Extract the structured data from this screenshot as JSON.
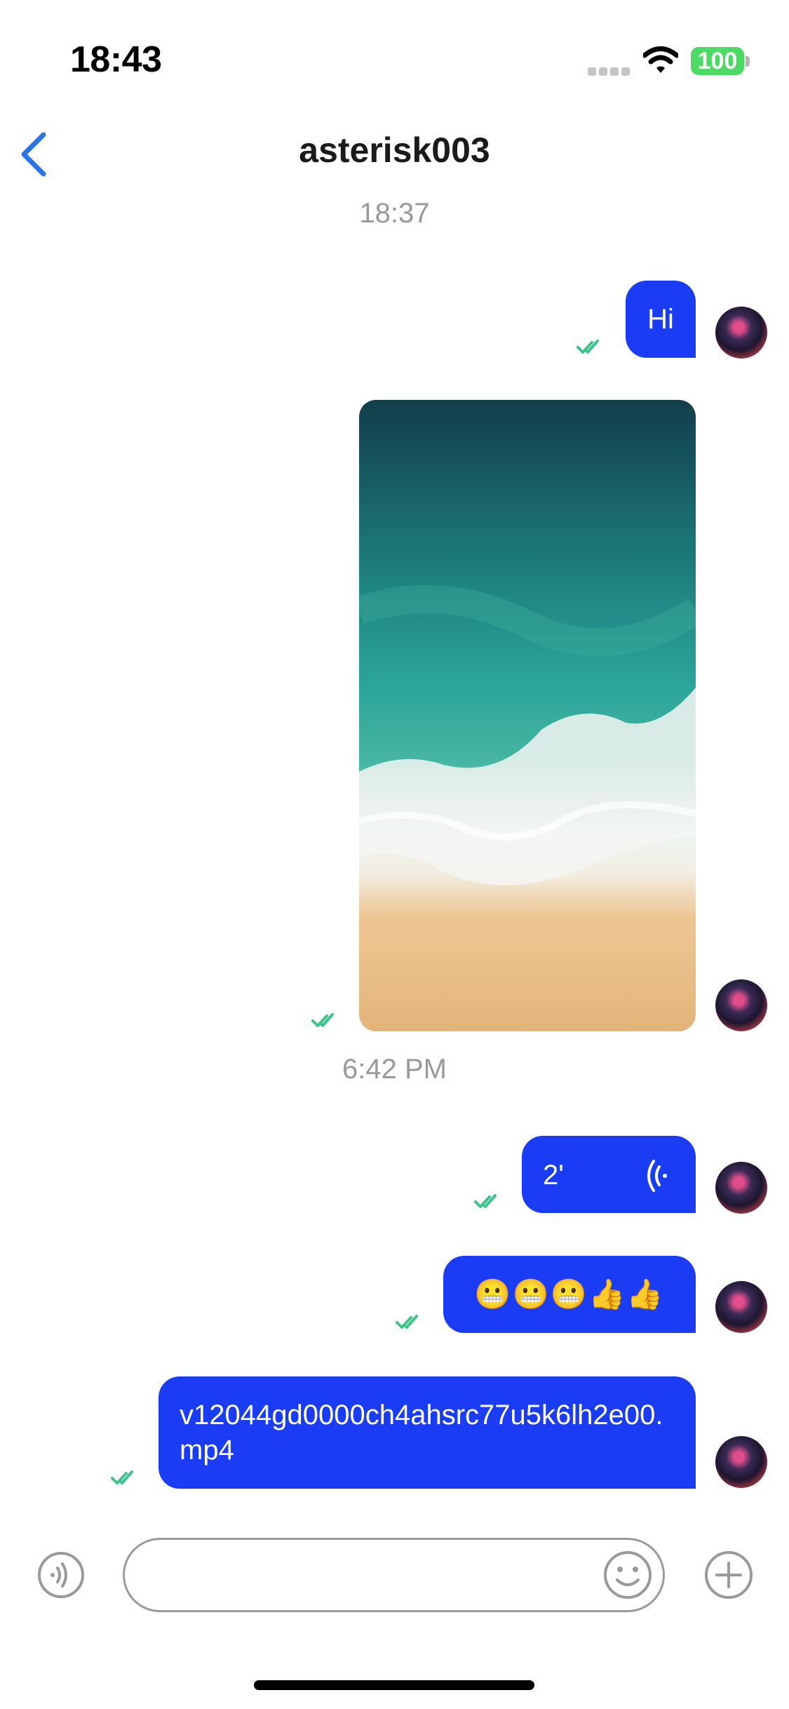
{
  "status_bar": {
    "time": "18:43",
    "battery": "100"
  },
  "nav": {
    "title": "asterisk003"
  },
  "colors": {
    "bubble": "#1a3cf5",
    "tick": "#3cc48b",
    "accent": "#2a74e6",
    "battery": "#4cd964"
  },
  "messages": {
    "timestamp_1": "18:37",
    "hi": {
      "text": "Hi",
      "status": "read"
    },
    "image": {
      "type": "image",
      "status": "read"
    },
    "timestamp_2": "6:42 PM",
    "voice": {
      "duration": "2'",
      "status": "read"
    },
    "emoji": {
      "text": "😬😬😬👍👍",
      "status": "read"
    },
    "file": {
      "text": "v12044gd0000ch4ahsrc77u5k6lh2e00.mp4",
      "status": "read"
    }
  },
  "composer": {
    "input_value": "",
    "icons": [
      "voice-icon",
      "emoji-icon",
      "add-icon"
    ]
  }
}
